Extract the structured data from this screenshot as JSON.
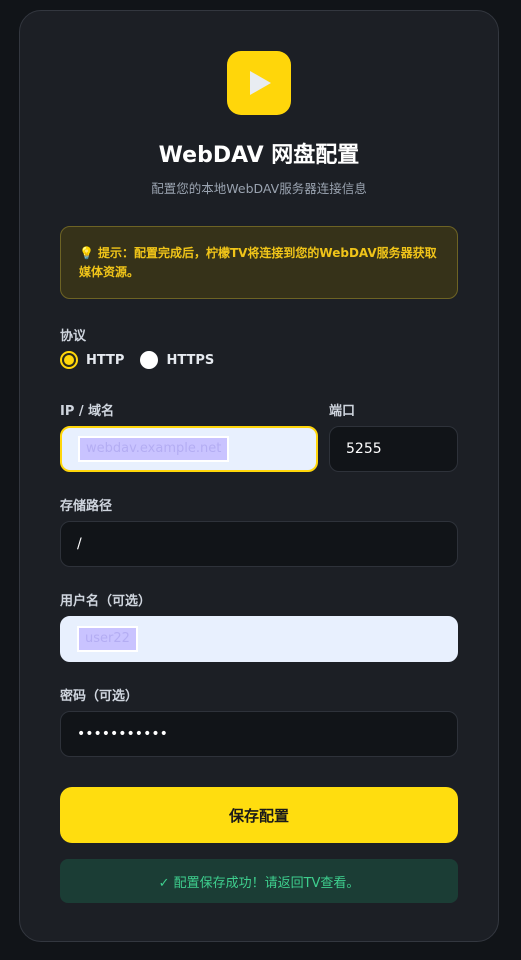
{
  "header": {
    "logo_icon": "play-icon",
    "title": "WebDAV 网盘配置",
    "subtitle": "配置您的本地WebDAV服务器连接信息"
  },
  "tip": {
    "icon": "lightbulb-icon",
    "text": "提示：配置完成后，柠檬TV将连接到您的WebDAV服务器获取媒体资源。"
  },
  "protocol": {
    "label": "协议",
    "options": [
      "HTTP",
      "HTTPS"
    ],
    "selected": "HTTP"
  },
  "host": {
    "label": "IP / 域名",
    "value": "webdav.example.net"
  },
  "port": {
    "label": "端口",
    "value": "5255"
  },
  "path": {
    "label": "存储路径",
    "value": "/"
  },
  "username": {
    "label": "用户名（可选）",
    "value": "user22"
  },
  "password": {
    "label": "密码（可选）",
    "value": "•••••••••••"
  },
  "save_button": "保存配置",
  "status": "✓ 配置保存成功！请返回TV查看。",
  "colors": {
    "accent": "#ffd60a",
    "background": "#1c1f25",
    "success": "#3ecf8e"
  }
}
